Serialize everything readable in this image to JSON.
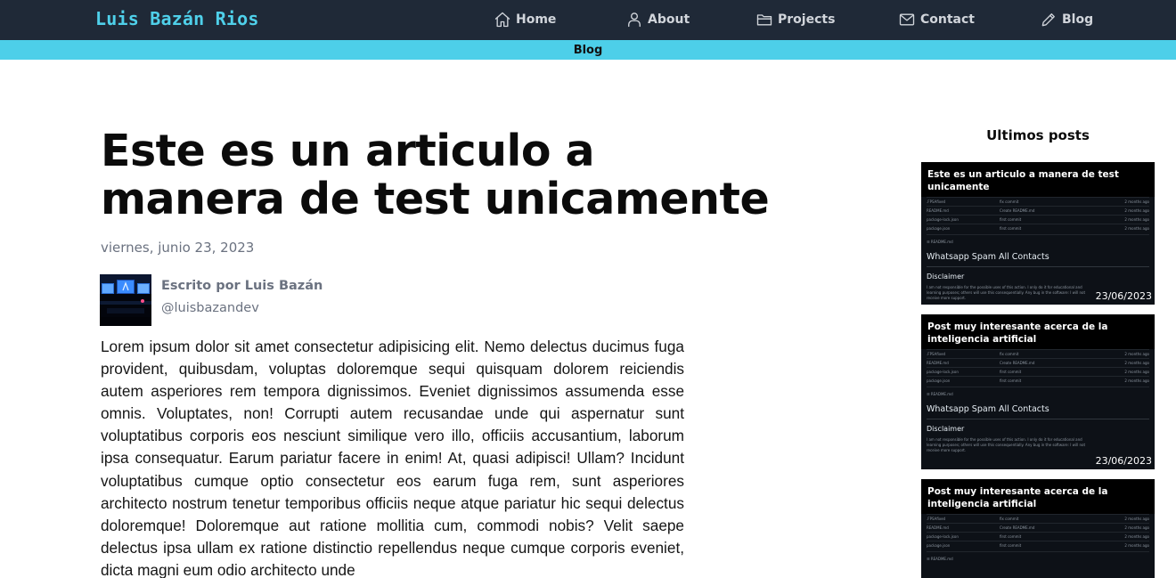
{
  "header": {
    "brand": "Luis Bazán Rios",
    "nav": [
      {
        "label": "Home",
        "icon": "home-icon"
      },
      {
        "label": "About",
        "icon": "user-icon"
      },
      {
        "label": "Projects",
        "icon": "folder-icon"
      },
      {
        "label": "Contact",
        "icon": "mail-icon"
      },
      {
        "label": "Blog",
        "icon": "pencil-icon"
      }
    ]
  },
  "subbar": {
    "label": "Blog"
  },
  "article": {
    "title": "Este es un articulo a manera de test unicamente",
    "date": "viernes, junio 23, 2023",
    "author": {
      "name": "Escrito por Luis Bazán",
      "handle": "@luisbazandev"
    },
    "body": "Lorem ipsum dolor sit amet consectetur adipisicing elit. Nemo delectus ducimus fuga provident, quibusdam, voluptas doloremque sequi quisquam dolorem reiciendis autem asperiores rem tempora dignissimos. Eveniet dignissimos assumenda esse omnis. Voluptates, non! Corrupti autem recusandae unde qui aspernatur sunt voluptatibus corporis eos nesciunt similique vero illo, officiis accusantium, laborum ipsa consequatur. Earum pariatur facere in enim! At, quasi adipisci! Ullam? Incidunt voluptatibus cumque optio consectetur eos earum fuga rem, sunt asperiores architecto nostrum tenetur temporibus officiis neque atque pariatur hic sequi delectus doloremque! Doloremque aut ratione mollitia cum, commodi nobis? Velit saepe delectus ipsa ullam ex ratione distinctio repellendus neque cumque corporis eveniet, dicta magni eum odio architecto unde"
  },
  "sidebar": {
    "title": "Ultimos posts",
    "posts": [
      {
        "title": "Este es un articulo a manera de test unicamente",
        "date": "23/06/2023",
        "thumb_heading": "Whatsapp Spam All Contacts",
        "thumb_sub": "Disclaimer"
      },
      {
        "title": "Post muy interesante acerca de la inteligencia artificial",
        "date": "23/06/2023",
        "thumb_heading": "Whatsapp Spam All Contacts",
        "thumb_sub": "Disclaimer"
      },
      {
        "title": "Post muy interesante acerca de la inteligencia artificial",
        "date": "",
        "thumb_heading": "",
        "thumb_sub": ""
      }
    ]
  },
  "colors": {
    "navbar_bg": "#1f2937",
    "brand": "#4fd0ea",
    "subbar_bg": "#4dcfe9",
    "muted_text": "#6b7280"
  }
}
